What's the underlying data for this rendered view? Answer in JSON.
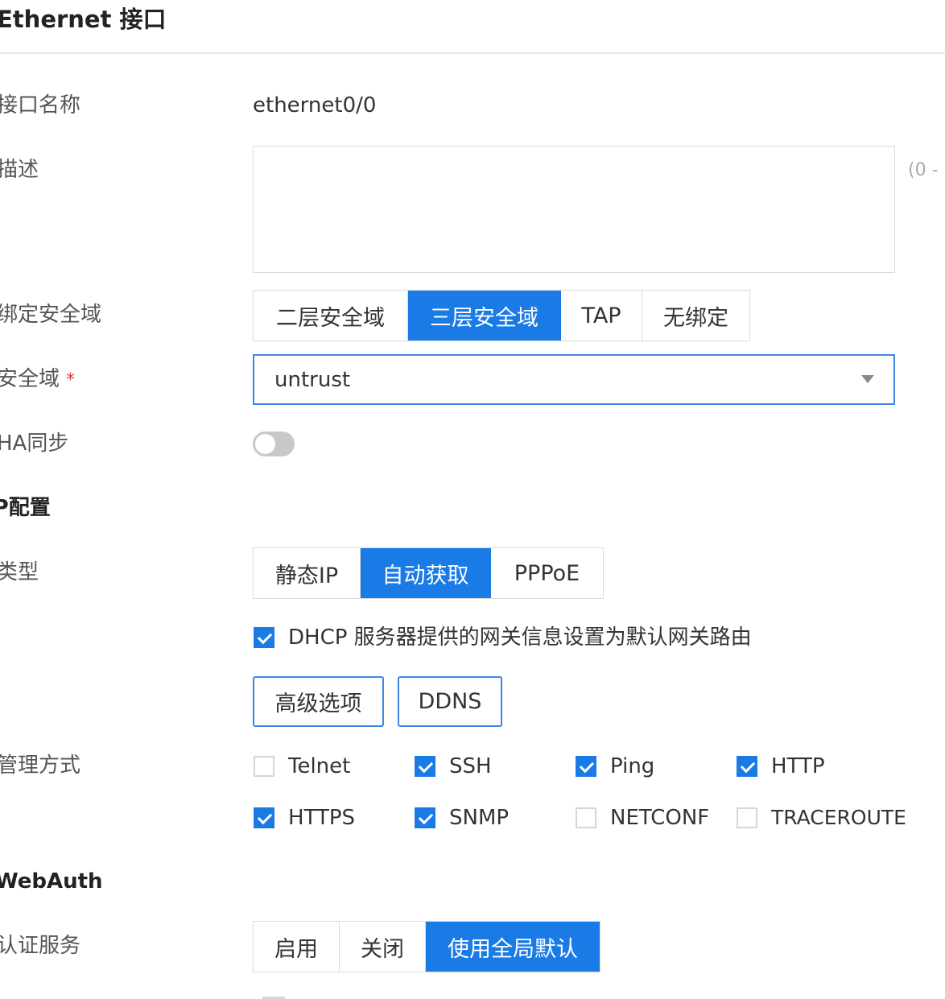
{
  "page": {
    "title": "Ethernet 接口"
  },
  "interface_name": {
    "label": "接口名称",
    "value": "ethernet0/0"
  },
  "description": {
    "label": "描述",
    "value": "",
    "hint": "(0 - "
  },
  "bind_zone": {
    "label": "绑定安全域",
    "options": [
      "二层安全域",
      "三层安全域",
      "TAP",
      "无绑定"
    ],
    "selected": "三层安全域"
  },
  "zone": {
    "label": "安全域",
    "required_mark": "*",
    "value": "untrust",
    "icon": "caret-down-icon"
  },
  "ha_sync": {
    "label": "HA同步",
    "enabled": false
  },
  "ip_config": {
    "section_title": "IP配置",
    "type_label": "类型",
    "type_options": [
      "静态IP",
      "自动获取",
      "PPPoE"
    ],
    "type_selected": "自动获取",
    "dhcp_gateway": {
      "label": "DHCP 服务器提供的网关信息设置为默认网关路由",
      "checked": true
    },
    "advanced_button": "高级选项",
    "ddns_button": "DDNS"
  },
  "management": {
    "label": "管理方式",
    "items": [
      {
        "name": "Telnet",
        "checked": false
      },
      {
        "name": "SSH",
        "checked": true
      },
      {
        "name": "Ping",
        "checked": true
      },
      {
        "name": "HTTP",
        "checked": true
      },
      {
        "name": "HTTPS",
        "checked": true
      },
      {
        "name": "SNMP",
        "checked": true
      },
      {
        "name": "NETCONF",
        "checked": false
      },
      {
        "name": "TRACEROUTE",
        "checked": false
      }
    ]
  },
  "webauth": {
    "section_title": "WebAuth",
    "auth_label": "认证服务",
    "options": [
      "启用",
      "关闭",
      "使用全局默认"
    ],
    "selected": "使用全局默认"
  },
  "colors": {
    "accent": "#1a7ae6",
    "border_focus": "#3b86e3",
    "required": "#e53935"
  }
}
